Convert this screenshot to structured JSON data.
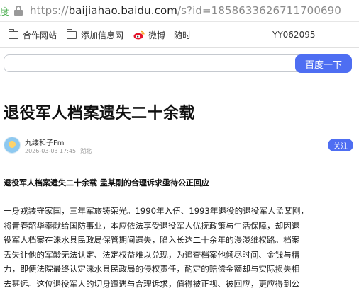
{
  "browser": {
    "site_tag": "度",
    "url_scheme": "https://",
    "url_host": "baijiahao.baidu.com",
    "url_path": "/s?id=1858633626711700690"
  },
  "bookmarks": {
    "items": [
      {
        "label": "合作网站",
        "icon": "folder-icon"
      },
      {
        "label": "添加信息网",
        "icon": "folder-icon"
      },
      {
        "label": "微博－随时",
        "icon": "weibo-icon"
      }
    ],
    "id_text": "YY062095"
  },
  "search": {
    "value": "",
    "button_label": "百度一下"
  },
  "article": {
    "title": "退役军人档案遗失二十余载",
    "author": {
      "name": "九缕和子Fm",
      "datetime": "2026-03-03 17:45",
      "location": "湖北"
    },
    "follow_label": "关注",
    "subheading": "退役军人档案遗失二十余载 孟某刚的合理诉求亟待公正回应",
    "body_lines": [
      "一身戎装守家国，三年军旅铸荣光。1990年入伍、1993年退役的退役军人孟某刚，",
      "将青春韶华奉献给国防事业，本应依法享受退役军人优抚政策与生活保障，却因退",
      "役军人档案在涞水县民政局保管期间遗失，陷入长达二十余年的漫漫维权路。档案",
      "丢失让他的军龄无法认定、法定权益难以兑现，为追查档案他倾尽时间、金钱与精",
      "力，即便法院最终认定涞水县民政局的侵权责任，酌定的赔偿金额却与实际损失相",
      "去甚远。这位退役军人的切身遭遇与合理诉求，值得被正视、被回应，更应得到公"
    ]
  }
}
